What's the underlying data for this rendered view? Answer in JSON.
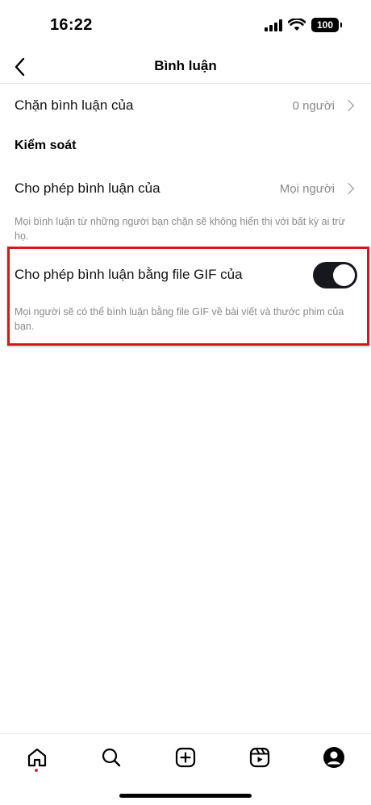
{
  "status_bar": {
    "time": "16:22",
    "battery": "100"
  },
  "header": {
    "title": "Bình luận",
    "back_icon": "chevron-left-icon"
  },
  "rows": {
    "block_comments": {
      "label": "Chặn bình luận của",
      "value": "0 người"
    },
    "section_heading": "Kiểm soát",
    "allow_comments": {
      "label": "Cho phép bình luận của",
      "value": "Mọi người"
    },
    "allow_comments_note": "Mọi bình luận từ những người bạn chặn sẽ không hiển thị với bất kỳ ai trừ họ.",
    "gif_comments": {
      "label": "Cho phép bình luận bằng file GIF của",
      "enabled": true
    },
    "gif_comments_note": "Mọi người sẽ có thể bình luận bằng file GIF về bài viết và thước phim của bạn."
  },
  "tab_bar": {
    "items": [
      "home-icon",
      "search-icon",
      "create-icon",
      "reels-icon",
      "profile-icon"
    ],
    "active": "home-icon"
  },
  "colors": {
    "highlight": "#d8141d",
    "toggle_on": "#16181d",
    "muted_text": "#8a8a8a",
    "notification_dot": "#e4243c"
  }
}
